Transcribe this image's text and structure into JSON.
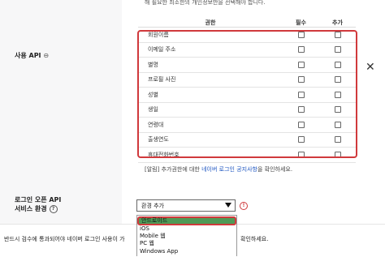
{
  "section": {
    "api_label": "사용 API",
    "api_link_icon": "link-icon",
    "env_label_line1": "로그인 오픈 API",
    "env_label_line2": "서비스 환경",
    "info_icon": "info-circle-icon"
  },
  "permissions": {
    "description": "해 필요한 최소한의 개인정보만을 선택해야 합니다.",
    "headers": {
      "name": "권한",
      "required": "필수",
      "optional": "추가"
    },
    "rows": [
      {
        "name": "회원이름",
        "required": false,
        "optional": false
      },
      {
        "name": "이메일 주소",
        "required": false,
        "optional": false
      },
      {
        "name": "별명",
        "required": false,
        "optional": false
      },
      {
        "name": "프로필 사진",
        "required": false,
        "optional": false
      },
      {
        "name": "성별",
        "required": false,
        "optional": false
      },
      {
        "name": "생일",
        "required": false,
        "optional": false
      },
      {
        "name": "연령대",
        "required": false,
        "optional": false
      },
      {
        "name": "출생연도",
        "required": false,
        "optional": false
      },
      {
        "name": "휴대전화번호",
        "required": false,
        "optional": false
      }
    ],
    "notice_prefix": "[알림] 추가권한에 대한 ",
    "notice_link": "네이버 로그인 공지사항",
    "notice_suffix": "을 확인하세요."
  },
  "close_symbol": "✕",
  "environment": {
    "select_value": "환경 추가",
    "warning_symbol": "!",
    "options": [
      "안드로이드",
      "iOS",
      "Mobile 웹",
      "PC 웹",
      "Windows App"
    ],
    "selected_index": 0
  },
  "footer": {
    "text_left": "반드시 검수에 통과되어야 네이버 로그인 사용이 가",
    "text_right": "확인하세요."
  },
  "colors": {
    "highlight_border": "#d0393c",
    "selected_option_bg": "#4f9a57",
    "link": "#1d55c0"
  }
}
